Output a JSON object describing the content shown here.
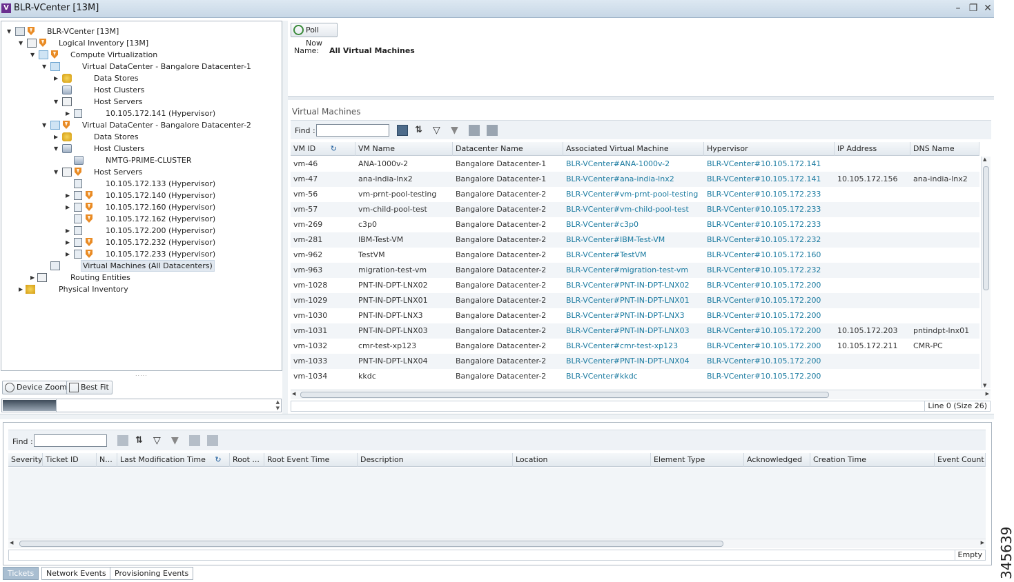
{
  "window": {
    "title": "BLR-VCenter [13M]"
  },
  "tree": {
    "root": "BLR-VCenter [13M]",
    "logical_inventory": "Logical Inventory [13M]",
    "compute_virtualization": "Compute Virtualization",
    "dc1": "Virtual DataCenter - Bangalore Datacenter-1",
    "dc1_data_stores": "Data Stores",
    "dc1_host_clusters": "Host Clusters",
    "dc1_host_servers": "Host Servers",
    "dc1_host_1": "10.105.172.141 (Hypervisor)",
    "dc2": "Virtual DataCenter - Bangalore Datacenter-2",
    "dc2_data_stores": "Data Stores",
    "dc2_host_clusters": "Host Clusters",
    "dc2_cluster": "NMTG-PRIME-CLUSTER",
    "dc2_host_servers": "Host Servers",
    "dc2_hosts": [
      "10.105.172.133 (Hypervisor)",
      "10.105.172.140 (Hypervisor)",
      "10.105.172.160 (Hypervisor)",
      "10.105.172.162 (Hypervisor)",
      "10.105.172.200 (Hypervisor)",
      "10.105.172.232 (Hypervisor)",
      "10.105.172.233 (Hypervisor)"
    ],
    "virtual_machines": "Virtual Machines (All Datacenters)",
    "routing_entities": "Routing Entities",
    "physical_inventory": "Physical Inventory"
  },
  "left_buttons": {
    "device_zoom": "Device Zoom",
    "best_fit": "Best Fit"
  },
  "detail": {
    "poll_now": "Poll Now",
    "name_label": "Name:",
    "name_value": "All Virtual Machines"
  },
  "vm_table": {
    "title": "Virtual Machines",
    "find_label": "Find :",
    "find_value": "",
    "columns": [
      "VM ID",
      "VM Name",
      "Datacenter Name",
      "Associated Virtual Machine",
      "Hypervisor",
      "IP Address",
      "DNS Name"
    ],
    "rows": [
      [
        "vm-46",
        "ANA-1000v-2",
        "Bangalore Datacenter-1",
        "BLR-VCenter#ANA-1000v-2",
        "BLR-VCenter#10.105.172.141",
        "",
        ""
      ],
      [
        "vm-47",
        "ana-india-lnx2",
        "Bangalore Datacenter-1",
        "BLR-VCenter#ana-india-lnx2",
        "BLR-VCenter#10.105.172.141",
        "10.105.172.156",
        "ana-india-lnx2"
      ],
      [
        "vm-56",
        "vm-prnt-pool-testing",
        "Bangalore Datacenter-2",
        "BLR-VCenter#vm-prnt-pool-testing",
        "BLR-VCenter#10.105.172.233",
        "",
        ""
      ],
      [
        "vm-57",
        "vm-child-pool-test",
        "Bangalore Datacenter-2",
        "BLR-VCenter#vm-child-pool-test",
        "BLR-VCenter#10.105.172.233",
        "",
        ""
      ],
      [
        "vm-269",
        "c3p0",
        "Bangalore Datacenter-2",
        "BLR-VCenter#c3p0",
        "BLR-VCenter#10.105.172.233",
        "",
        ""
      ],
      [
        "vm-281",
        "IBM-Test-VM",
        "Bangalore Datacenter-2",
        "BLR-VCenter#IBM-Test-VM",
        "BLR-VCenter#10.105.172.232",
        "",
        ""
      ],
      [
        "vm-962",
        "TestVM",
        "Bangalore Datacenter-2",
        "BLR-VCenter#TestVM",
        "BLR-VCenter#10.105.172.160",
        "",
        ""
      ],
      [
        "vm-963",
        "migration-test-vm",
        "Bangalore Datacenter-2",
        "BLR-VCenter#migration-test-vm",
        "BLR-VCenter#10.105.172.232",
        "",
        ""
      ],
      [
        "vm-1028",
        "PNT-IN-DPT-LNX02",
        "Bangalore Datacenter-2",
        "BLR-VCenter#PNT-IN-DPT-LNX02",
        "BLR-VCenter#10.105.172.200",
        "",
        ""
      ],
      [
        "vm-1029",
        "PNT-IN-DPT-LNX01",
        "Bangalore Datacenter-2",
        "BLR-VCenter#PNT-IN-DPT-LNX01",
        "BLR-VCenter#10.105.172.200",
        "",
        ""
      ],
      [
        "vm-1030",
        "PNT-IN-DPT-LNX3",
        "Bangalore Datacenter-2",
        "BLR-VCenter#PNT-IN-DPT-LNX3",
        "BLR-VCenter#10.105.172.200",
        "",
        ""
      ],
      [
        "vm-1031",
        "PNT-IN-DPT-LNX03",
        "Bangalore Datacenter-2",
        "BLR-VCenter#PNT-IN-DPT-LNX03",
        "BLR-VCenter#10.105.172.200",
        "10.105.172.203",
        "pntindpt-lnx01"
      ],
      [
        "vm-1032",
        "cmr-test-xp123",
        "Bangalore Datacenter-2",
        "BLR-VCenter#cmr-test-xp123",
        "BLR-VCenter#10.105.172.200",
        "10.105.172.211",
        "CMR-PC"
      ],
      [
        "vm-1033",
        "PNT-IN-DPT-LNX04",
        "Bangalore Datacenter-2",
        "BLR-VCenter#PNT-IN-DPT-LNX04",
        "BLR-VCenter#10.105.172.200",
        "",
        ""
      ],
      [
        "vm-1034",
        "kkdc",
        "Bangalore Datacenter-2",
        "BLR-VCenter#kkdc",
        "BLR-VCenter#10.105.172.200",
        "",
        ""
      ]
    ],
    "status": "Line 0 (Size 26)"
  },
  "events": {
    "find_label": "Find :",
    "find_value": "",
    "columns": [
      "Severity",
      "Ticket ID",
      "N...",
      "Last Modification Time",
      "Root ...",
      "Root Event Time",
      "Description",
      "Location",
      "Element Type",
      "Acknowledged",
      "Creation Time",
      "Event Count"
    ],
    "status": "Empty"
  },
  "tabs": [
    "Tickets",
    "Network Events",
    "Provisioning Events"
  ],
  "figure_number": "345639",
  "colors": {
    "link": "#1a7aa0",
    "titlebar": "#c7d7e6",
    "active_tab": "#a9bed1",
    "alarm_shield": "#e98b25"
  }
}
